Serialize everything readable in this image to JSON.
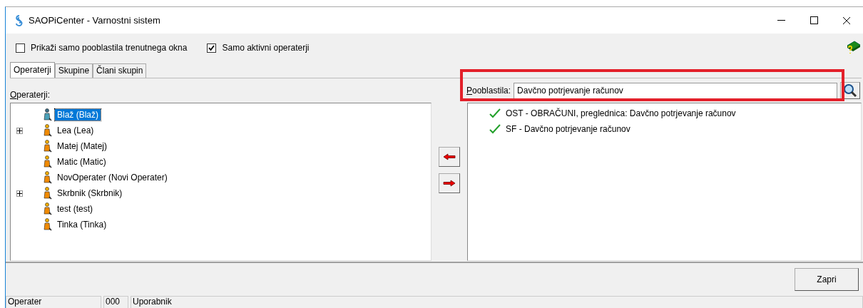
{
  "window": {
    "title": "SAOPiCenter - Varnostni sistem"
  },
  "options": [
    {
      "label": "Prikaži samo pooblastila trenutnega okna",
      "checked": false
    },
    {
      "label": "Samo aktivni operaterji",
      "checked": true
    }
  ],
  "tabs": [
    {
      "label": "Operaterji",
      "selected": true
    },
    {
      "label": "Skupine",
      "selected": false
    },
    {
      "label": "Člani skupin",
      "selected": false
    }
  ],
  "operators_label": "Operaterji:",
  "operators": [
    {
      "label": "Blaž (Blaž)",
      "kind": "leaf",
      "selected": true
    },
    {
      "label": "Lea (Lea)",
      "kind": "group",
      "selected": false
    },
    {
      "label": "Matej (Matej)",
      "kind": "leaf",
      "selected": false
    },
    {
      "label": "Matic (Matic)",
      "kind": "leaf",
      "selected": false
    },
    {
      "label": "NovOperater (Novi Operater)",
      "kind": "leaf",
      "selected": false
    },
    {
      "label": "Skrbnik (Skrbnik)",
      "kind": "group",
      "selected": false
    },
    {
      "label": "test (test)",
      "kind": "leaf",
      "selected": false
    },
    {
      "label": "Tinka (Tinka)",
      "kind": "leaf",
      "selected": false
    }
  ],
  "permissions_label": "Pooblastila:",
  "permissions_search": {
    "value": "Davčno potrjevanje računov"
  },
  "permissions": [
    {
      "label": "OST - OBRAČUNI, preglednica: Davčno potrjevanje računov"
    },
    {
      "label": "SF - Davčno potrjevanje računov"
    }
  ],
  "close_button": "Zapri",
  "status_bar": [
    "Operater",
    "000",
    "Uporabnik"
  ]
}
